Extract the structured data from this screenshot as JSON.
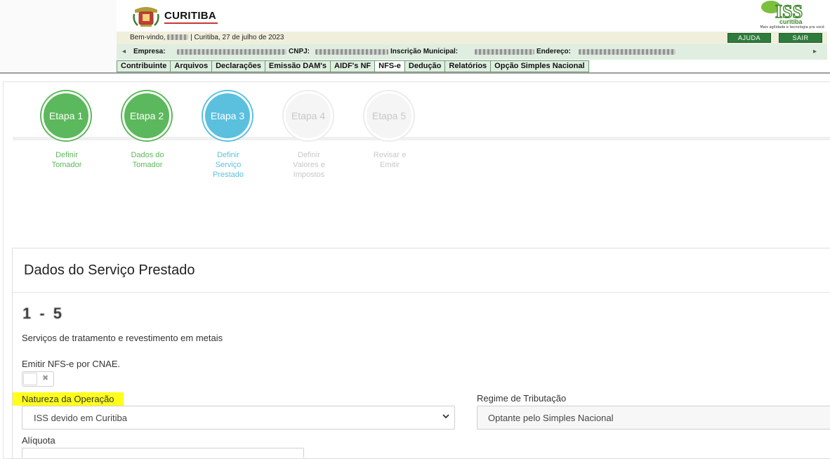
{
  "header": {
    "city_name": "CURITIBA",
    "iss_logo_text": "ISS",
    "iss_logo_sub": "curitiba",
    "iss_tagline": "Mais agilidade e tecnologia pra você",
    "welcome_prefix": "Bem-vindo,",
    "welcome_suffix": "| Curitiba, 27 de julho de 2023",
    "help_label": "AJUDA",
    "exit_label": "SAIR",
    "empresa_label": "Empresa:",
    "cnpj_label": "CNPJ:",
    "inscricao_label": "Inscrição Municipal:",
    "endereco_label": "Endereço:",
    "scroll_left": "◂",
    "scroll_right": "▸"
  },
  "menu": {
    "items": [
      {
        "label": "Contribuinte"
      },
      {
        "label": "Arquivos"
      },
      {
        "label": "Declarações"
      },
      {
        "label": "Emissão DAM's"
      },
      {
        "label": "AIDF's NF"
      },
      {
        "label": "NFS-e",
        "active": true
      },
      {
        "label": "Dedução"
      },
      {
        "label": "Relatórios"
      },
      {
        "label": "Opção Simples Nacional"
      }
    ]
  },
  "wizard": {
    "steps": [
      {
        "label": "Etapa 1",
        "caption": "Definir Tomador",
        "state": "done"
      },
      {
        "label": "Etapa 2",
        "caption": "Dados do Tomador",
        "state": "done"
      },
      {
        "label": "Etapa 3",
        "caption": "Definir Serviço Prestado",
        "state": "current"
      },
      {
        "label": "Etapa 4",
        "caption": "Definir Valores e Impostos",
        "state": "todo"
      },
      {
        "label": "Etapa 5",
        "caption": "Revisar e Emitir",
        "state": "todo"
      }
    ]
  },
  "form": {
    "title": "Dados do Serviço Prestado",
    "service_code": "1 - 5",
    "service_description": "Serviços de tratamento e revestimento em metais",
    "cnae_label": "Emitir NFS-e por CNAE.",
    "cnae_toggle_off_symbol": "✖",
    "natureza_label": "Natureza da Operação",
    "natureza_value": "ISS devido em Curitiba",
    "regime_label": "Regime de Tributação",
    "regime_value": "Optante pelo Simples Nacional",
    "aliquota_label": "Alíquota"
  },
  "colors": {
    "step_done": "#5cb85c",
    "step_current": "#5bc0de",
    "step_todo": "#f5f5f5",
    "menu_green": "#2f7b3e",
    "highlight": "#ffff1a"
  }
}
